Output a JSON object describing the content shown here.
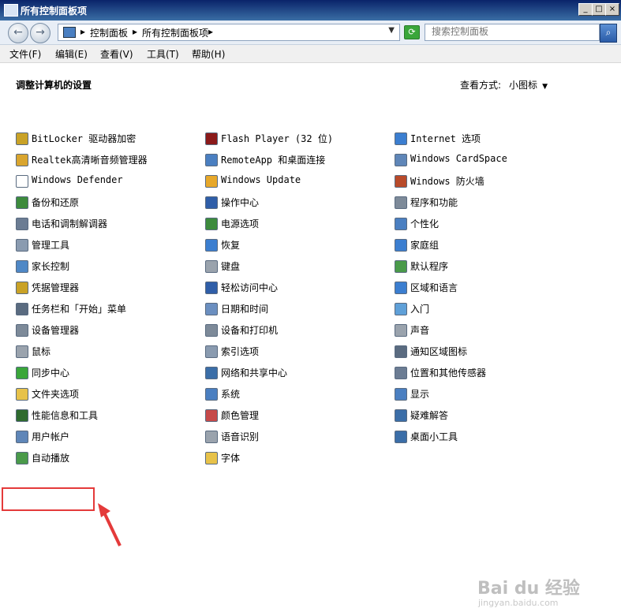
{
  "window": {
    "title": "所有控制面板项"
  },
  "address": {
    "crumbs": [
      "控制面板",
      "所有控制面板项"
    ],
    "separator": "▸"
  },
  "search": {
    "placeholder": "搜索控制面板"
  },
  "menu": [
    "文件(F)",
    "编辑(E)",
    "查看(V)",
    "工具(T)",
    "帮助(H)"
  ],
  "heading": "调整计算机的设置",
  "view": {
    "label": "查看方式:",
    "value": "小图标"
  },
  "items": [
    {
      "label": "BitLocker 驱动器加密",
      "icon": "bitlocker-icon",
      "color": "#c9a227"
    },
    {
      "label": "Realtek高清晰音频管理器",
      "icon": "realtek-audio-icon",
      "color": "#d9a52f"
    },
    {
      "label": "Windows Defender",
      "icon": "defender-icon",
      "color": "#ffffff"
    },
    {
      "label": "备份和还原",
      "icon": "backup-icon",
      "color": "#3d8b3d"
    },
    {
      "label": "电话和调制解调器",
      "icon": "phone-modem-icon",
      "color": "#6b7c93"
    },
    {
      "label": "管理工具",
      "icon": "admin-tools-icon",
      "color": "#8a9bb0"
    },
    {
      "label": "家长控制",
      "icon": "parental-control-icon",
      "color": "#4f88c6"
    },
    {
      "label": "凭据管理器",
      "icon": "credential-manager-icon",
      "color": "#c9a227"
    },
    {
      "label": "任务栏和「开始」菜单",
      "icon": "taskbar-icon",
      "color": "#5a6b80"
    },
    {
      "label": "设备管理器",
      "icon": "device-manager-icon",
      "color": "#7d8a99"
    },
    {
      "label": "鼠标",
      "icon": "mouse-icon",
      "color": "#9aa3ad"
    },
    {
      "label": "同步中心",
      "icon": "sync-center-icon",
      "color": "#3aa63a"
    },
    {
      "label": "文件夹选项",
      "icon": "folder-options-icon",
      "color": "#e7c24a"
    },
    {
      "label": "性能信息和工具",
      "icon": "performance-icon",
      "color": "#2f6b2f"
    },
    {
      "label": "用户帐户",
      "icon": "user-accounts-icon",
      "color": "#5f86b8"
    },
    {
      "label": "自动播放",
      "icon": "autoplay-icon",
      "color": "#4a9a4a"
    },
    {
      "label": "Flash Player (32 位)",
      "icon": "flash-player-icon",
      "color": "#8b1a1a"
    },
    {
      "label": "RemoteApp 和桌面连接",
      "icon": "remoteapp-icon",
      "color": "#4a7fc1"
    },
    {
      "label": "Windows Update",
      "icon": "windows-update-icon",
      "color": "#e7a82a"
    },
    {
      "label": "操作中心",
      "icon": "action-center-icon",
      "color": "#2f5ea8"
    },
    {
      "label": "电源选项",
      "icon": "power-options-icon",
      "color": "#3d8b3d"
    },
    {
      "label": "恢复",
      "icon": "recovery-icon",
      "color": "#3b7ed0"
    },
    {
      "label": "键盘",
      "icon": "keyboard-icon",
      "color": "#9aa3ad"
    },
    {
      "label": "轻松访问中心",
      "icon": "ease-of-access-icon",
      "color": "#2f5ea8"
    },
    {
      "label": "日期和时间",
      "icon": "date-time-icon",
      "color": "#6b8fc0"
    },
    {
      "label": "设备和打印机",
      "icon": "printer-icon",
      "color": "#7d8a99"
    },
    {
      "label": "索引选项",
      "icon": "indexing-icon",
      "color": "#8a9bb0"
    },
    {
      "label": "网络和共享中心",
      "icon": "network-icon",
      "color": "#3b6ea8"
    },
    {
      "label": "系统",
      "icon": "system-icon",
      "color": "#4a7fc1"
    },
    {
      "label": "颜色管理",
      "icon": "color-management-icon",
      "color": "#c64a4a"
    },
    {
      "label": "语音识别",
      "icon": "speech-icon",
      "color": "#9aa3ad"
    },
    {
      "label": "字体",
      "icon": "fonts-icon",
      "color": "#e7c24a"
    },
    {
      "label": "Internet 选项",
      "icon": "internet-options-icon",
      "color": "#3b7ed0"
    },
    {
      "label": "Windows CardSpace",
      "icon": "cardspace-icon",
      "color": "#5f86b8"
    },
    {
      "label": "Windows 防火墙",
      "icon": "firewall-icon",
      "color": "#b84a2a"
    },
    {
      "label": "程序和功能",
      "icon": "programs-icon",
      "color": "#7d8a99"
    },
    {
      "label": "个性化",
      "icon": "personalization-icon",
      "color": "#4a7fc1"
    },
    {
      "label": "家庭组",
      "icon": "homegroup-icon",
      "color": "#3b7ed0"
    },
    {
      "label": "默认程序",
      "icon": "default-programs-icon",
      "color": "#4a9a4a"
    },
    {
      "label": "区域和语言",
      "icon": "region-language-icon",
      "color": "#3b7ed0"
    },
    {
      "label": "入门",
      "icon": "getting-started-icon",
      "color": "#5fa0d8"
    },
    {
      "label": "声音",
      "icon": "sound-icon",
      "color": "#9aa3ad"
    },
    {
      "label": "通知区域图标",
      "icon": "notification-icon",
      "color": "#5a6b80"
    },
    {
      "label": "位置和其他传感器",
      "icon": "location-sensors-icon",
      "color": "#6b7c93"
    },
    {
      "label": "显示",
      "icon": "display-icon",
      "color": "#4a7fc1"
    },
    {
      "label": "疑难解答",
      "icon": "troubleshooting-icon",
      "color": "#3b6ea8"
    },
    {
      "label": "桌面小工具",
      "icon": "gadgets-icon",
      "color": "#3b6ea8"
    }
  ],
  "watermark": {
    "brand": "Bai du 经验",
    "url": "jingyan.baidu.com"
  }
}
